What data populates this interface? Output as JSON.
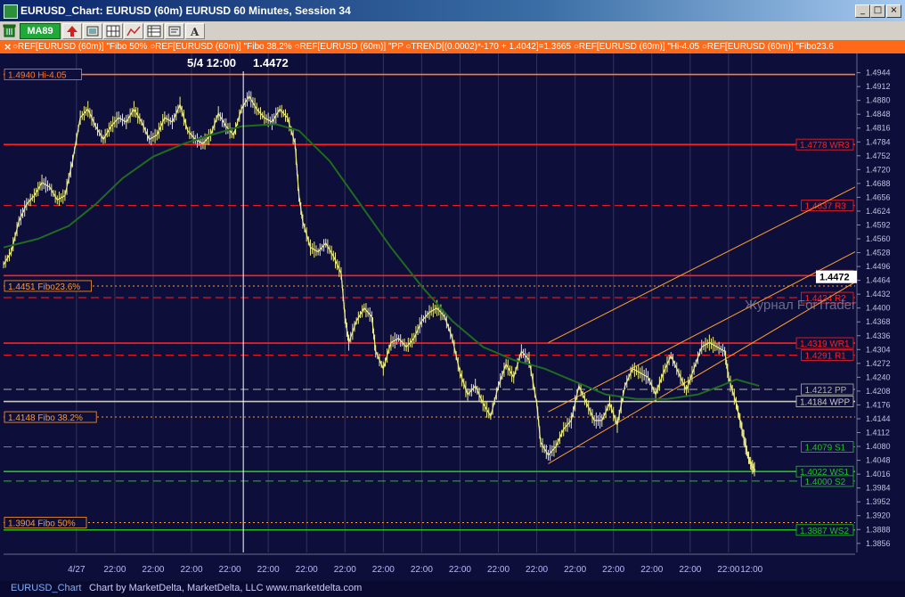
{
  "window": {
    "title": "EURUSD_Chart: EURUSD (60m) EURUSD 60 Minutes, Session 34",
    "controls": {
      "minimize": "_",
      "maximize": "□",
      "close": "×"
    }
  },
  "toolbar": {
    "ma_label": "MA89",
    "icons": [
      "trash-icon",
      "up-arrow-icon",
      "rectangle-tool-icon",
      "grid-icon",
      "xyz-tool-icon",
      "table-icon",
      "settings-icon",
      "text-tool-icon"
    ]
  },
  "studies_bar": {
    "close": "×",
    "text": "○REF[EURUSD (60m)] \"Fibo 50% ○REF[EURUSD (60m)] \"Fibo 38,2% ○REF[EURUSD (60m)] \"PP ○TREND[(0.0002)*-170 + 1.4042]=1.3665 ○REF[EURUSD (60m)] \"Hi-4.05 ○REF[EURUSD (60m)] \"Fibo23.6"
  },
  "status_bar": {
    "name": "EURUSD_Chart",
    "credit": "Chart by MarketDelta, MarketDelta, LLC www.marketdelta.com"
  },
  "chart_data": {
    "type": "line",
    "ylim": [
      1.3835,
      1.4972
    ],
    "y_ticks": [
      "1.4944",
      "1.4912",
      "1.4880",
      "1.4848",
      "1.4816",
      "1.4784",
      "1.4752",
      "1.4720",
      "1.4688",
      "1.4656",
      "1.4624",
      "1.4592",
      "1.4560",
      "1.4528",
      "1.4496",
      "1.4464",
      "1.4432",
      "1.4400",
      "1.4368",
      "1.4336",
      "1.4304",
      "1.4272",
      "1.4240",
      "1.4208",
      "1.4176",
      "1.4144",
      "1.4112",
      "1.4080",
      "1.4048",
      "1.4016",
      "1.3984",
      "1.3952",
      "1.3920",
      "1.3888",
      "1.3856"
    ],
    "x_ticks": [
      {
        "label": "4/27",
        "x": 2.0
      },
      {
        "label": "22:00",
        "x": 3.0
      },
      {
        "label": "22:00",
        "x": 4.0
      },
      {
        "label": "22:00",
        "x": 5.0
      },
      {
        "label": "22:00",
        "x": 6.0
      },
      {
        "label": "22:00",
        "x": 7.0
      },
      {
        "label": "22:00",
        "x": 8.0
      },
      {
        "label": "22:00",
        "x": 9.0
      },
      {
        "label": "22:00",
        "x": 10.0
      },
      {
        "label": "22:00",
        "x": 11.0
      },
      {
        "label": "22:00",
        "x": 12.0
      },
      {
        "label": "22:00",
        "x": 13.0
      },
      {
        "label": "22:00",
        "x": 14.0
      },
      {
        "label": "22:00",
        "x": 15.0
      },
      {
        "label": "22:00",
        "x": 16.0
      },
      {
        "label": "22:00",
        "x": 17.0
      },
      {
        "label": "22:00",
        "x": 18.0
      },
      {
        "label": "22:00",
        "x": 19.0
      },
      {
        "label": "12:00",
        "x": 19.6
      }
    ],
    "xlim": [
      0.1,
      22.3
    ],
    "cursor": {
      "date_label": "5/4 12:00",
      "price_label": "1.4472",
      "x": 6.35,
      "y": 1.4472
    },
    "price_marker": {
      "label": "1.4472",
      "y": 1.4472
    },
    "levels": [
      {
        "label": "1.4940 Hi-4.05",
        "y": 1.494,
        "color": "#ff7a2a",
        "style": "solid",
        "side": "left"
      },
      {
        "label": "1.4778 WR3",
        "y": 1.4778,
        "color": "#ff2020",
        "style": "solid",
        "side": "right"
      },
      {
        "label": "1.4637 R3",
        "y": 1.4637,
        "color": "#ff2020",
        "style": "dash",
        "side": "right"
      },
      {
        "label": "1.4472",
        "y": 1.4475,
        "color": "#ff2020",
        "style": "solid",
        "side": "right"
      },
      {
        "label": "1.4451 Fibo23.6%",
        "y": 1.4451,
        "color": "#ff9a30",
        "style": "dot",
        "side": "left"
      },
      {
        "label": "1.4424 R2",
        "y": 1.4424,
        "color": "#ff2020",
        "style": "dash",
        "side": "right"
      },
      {
        "label": "1.4319 WR1",
        "y": 1.4319,
        "color": "#ff2020",
        "style": "solid",
        "side": "right"
      },
      {
        "label": "1.4291 R1",
        "y": 1.4291,
        "color": "#ff2020",
        "style": "dash",
        "side": "right"
      },
      {
        "label": "1.4212 PP",
        "y": 1.4212,
        "color": "#b0b0b0",
        "style": "dash",
        "side": "right"
      },
      {
        "label": "1.4184 WPP",
        "y": 1.4184,
        "color": "#c8c8c8",
        "style": "solid",
        "side": "right"
      },
      {
        "label": "1.4148 Fibo 38.2%",
        "y": 1.4148,
        "color": "#ff9a30",
        "style": "dot",
        "side": "left"
      },
      {
        "label": "1.4079 S1",
        "y": 1.4079,
        "color": "#20c020",
        "style": "dash",
        "side": "right"
      },
      {
        "label": "1.4022 WS1",
        "y": 1.4022,
        "color": "#20c020",
        "style": "solid",
        "side": "right"
      },
      {
        "label": "1.4000 S2",
        "y": 1.4,
        "color": "#20c020",
        "style": "dash",
        "side": "right"
      },
      {
        "label": "1.3904 Fibo 50%",
        "y": 1.3904,
        "color": "#ff9a30",
        "style": "dot",
        "side": "left"
      },
      {
        "label": "1.3887 WS2",
        "y": 1.3887,
        "color": "#20c020",
        "style": "solid",
        "side": "right"
      }
    ],
    "watermark": "Журнал ForTrader.ru",
    "channel": [
      {
        "x1": 14.3,
        "y1": 1.432,
        "x2": 22.3,
        "y2": 1.468
      },
      {
        "x1": 14.3,
        "y1": 1.416,
        "x2": 22.3,
        "y2": 1.453
      },
      {
        "x1": 14.3,
        "y1": 1.404,
        "x2": 22.3,
        "y2": 1.446
      }
    ],
    "series": [
      {
        "kind": "price",
        "color": "#eeee88",
        "points": [
          [
            0.1,
            1.45
          ],
          [
            0.3,
            1.453
          ],
          [
            0.5,
            1.46
          ],
          [
            0.7,
            1.464
          ],
          [
            0.9,
            1.466
          ],
          [
            1.1,
            1.469
          ],
          [
            1.3,
            1.468
          ],
          [
            1.5,
            1.465
          ],
          [
            1.7,
            1.466
          ],
          [
            1.9,
            1.474
          ],
          [
            2.1,
            1.484
          ],
          [
            2.3,
            1.486
          ],
          [
            2.5,
            1.482
          ],
          [
            2.7,
            1.479
          ],
          [
            2.9,
            1.482
          ],
          [
            3.1,
            1.484
          ],
          [
            3.3,
            1.483
          ],
          [
            3.5,
            1.486
          ],
          [
            3.7,
            1.483
          ],
          [
            3.9,
            1.479
          ],
          [
            4.1,
            1.48
          ],
          [
            4.3,
            1.484
          ],
          [
            4.5,
            1.483
          ],
          [
            4.7,
            1.487
          ],
          [
            4.9,
            1.481
          ],
          [
            5.1,
            1.479
          ],
          [
            5.3,
            1.478
          ],
          [
            5.5,
            1.48
          ],
          [
            5.7,
            1.485
          ],
          [
            5.9,
            1.482
          ],
          [
            6.1,
            1.48
          ],
          [
            6.3,
            1.486
          ],
          [
            6.5,
            1.489
          ],
          [
            6.7,
            1.486
          ],
          [
            6.9,
            1.484
          ],
          [
            7.1,
            1.483
          ],
          [
            7.3,
            1.486
          ],
          [
            7.5,
            1.484
          ],
          [
            7.7,
            1.478
          ],
          [
            7.8,
            1.466
          ],
          [
            7.9,
            1.46
          ],
          [
            8.1,
            1.454
          ],
          [
            8.3,
            1.453
          ],
          [
            8.5,
            1.455
          ],
          [
            8.7,
            1.452
          ],
          [
            8.9,
            1.448
          ],
          [
            9.0,
            1.438
          ],
          [
            9.1,
            1.432
          ],
          [
            9.3,
            1.437
          ],
          [
            9.5,
            1.44
          ],
          [
            9.7,
            1.438
          ],
          [
            9.8,
            1.43
          ],
          [
            10.0,
            1.426
          ],
          [
            10.2,
            1.432
          ],
          [
            10.4,
            1.433
          ],
          [
            10.6,
            1.431
          ],
          [
            10.8,
            1.433
          ],
          [
            11.0,
            1.437
          ],
          [
            11.2,
            1.439
          ],
          [
            11.4,
            1.44
          ],
          [
            11.6,
            1.438
          ],
          [
            11.8,
            1.433
          ],
          [
            12.0,
            1.425
          ],
          [
            12.2,
            1.42
          ],
          [
            12.4,
            1.422
          ],
          [
            12.6,
            1.418
          ],
          [
            12.8,
            1.415
          ],
          [
            13.0,
            1.422
          ],
          [
            13.2,
            1.427
          ],
          [
            13.4,
            1.424
          ],
          [
            13.6,
            1.43
          ],
          [
            13.8,
            1.428
          ],
          [
            14.0,
            1.418
          ],
          [
            14.1,
            1.409
          ],
          [
            14.3,
            1.406
          ],
          [
            14.5,
            1.408
          ],
          [
            14.7,
            1.412
          ],
          [
            14.9,
            1.414
          ],
          [
            15.1,
            1.422
          ],
          [
            15.3,
            1.418
          ],
          [
            15.5,
            1.414
          ],
          [
            15.7,
            1.414
          ],
          [
            15.9,
            1.418
          ],
          [
            16.1,
            1.413
          ],
          [
            16.3,
            1.422
          ],
          [
            16.5,
            1.426
          ],
          [
            16.7,
            1.425
          ],
          [
            16.9,
            1.424
          ],
          [
            17.1,
            1.42
          ],
          [
            17.3,
            1.425
          ],
          [
            17.5,
            1.429
          ],
          [
            17.7,
            1.425
          ],
          [
            17.9,
            1.421
          ],
          [
            18.1,
            1.426
          ],
          [
            18.3,
            1.431
          ],
          [
            18.5,
            1.432
          ],
          [
            18.7,
            1.431
          ],
          [
            18.9,
            1.43
          ],
          [
            19.0,
            1.424
          ],
          [
            19.2,
            1.418
          ],
          [
            19.3,
            1.414
          ],
          [
            19.4,
            1.41
          ],
          [
            19.5,
            1.406
          ],
          [
            19.6,
            1.4035
          ],
          [
            19.7,
            1.4025
          ]
        ]
      },
      {
        "kind": "ma",
        "color": "#1f6b1f",
        "points": [
          [
            0.1,
            1.454
          ],
          [
            1.0,
            1.456
          ],
          [
            1.8,
            1.459
          ],
          [
            2.5,
            1.464
          ],
          [
            3.2,
            1.47
          ],
          [
            4.0,
            1.475
          ],
          [
            4.8,
            1.478
          ],
          [
            5.5,
            1.48
          ],
          [
            6.3,
            1.482
          ],
          [
            7.2,
            1.4825
          ],
          [
            7.8,
            1.481
          ],
          [
            8.6,
            1.474
          ],
          [
            9.4,
            1.464
          ],
          [
            10.2,
            1.454
          ],
          [
            11.0,
            1.445
          ],
          [
            11.8,
            1.437
          ],
          [
            12.6,
            1.431
          ],
          [
            13.4,
            1.428
          ],
          [
            14.2,
            1.426
          ],
          [
            15.0,
            1.423
          ],
          [
            15.8,
            1.42
          ],
          [
            16.6,
            1.419
          ],
          [
            17.4,
            1.419
          ],
          [
            18.2,
            1.42
          ],
          [
            18.8,
            1.422
          ],
          [
            19.2,
            1.4235
          ],
          [
            19.8,
            1.422
          ]
        ]
      }
    ]
  }
}
